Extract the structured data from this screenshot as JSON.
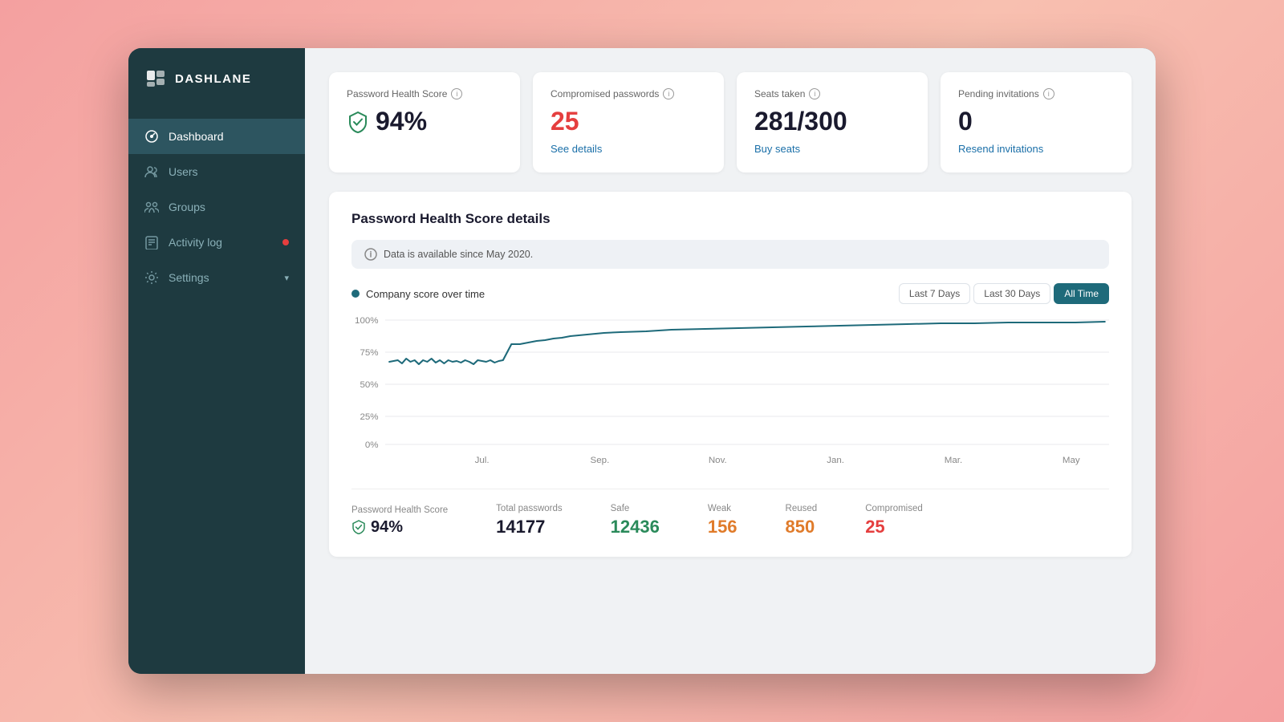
{
  "app": {
    "name": "DASHLANE"
  },
  "sidebar": {
    "items": [
      {
        "id": "dashboard",
        "label": "Dashboard",
        "icon": "dashboard-icon",
        "active": true
      },
      {
        "id": "users",
        "label": "Users",
        "icon": "users-icon",
        "active": false
      },
      {
        "id": "groups",
        "label": "Groups",
        "icon": "groups-icon",
        "active": false
      },
      {
        "id": "activity-log",
        "label": "Activity log",
        "icon": "activity-icon",
        "active": false,
        "badge": true
      },
      {
        "id": "settings",
        "label": "Settings",
        "icon": "settings-icon",
        "active": false,
        "chevron": true
      }
    ]
  },
  "stats": {
    "health_score": {
      "title": "Password Health Score",
      "value": "94%",
      "link": null
    },
    "compromised": {
      "title": "Compromised passwords",
      "value": "25",
      "link": "See details"
    },
    "seats": {
      "title": "Seats taken",
      "value": "281/300",
      "link": "Buy seats"
    },
    "invitations": {
      "title": "Pending invitations",
      "value": "0",
      "link": "Resend invitations"
    }
  },
  "chart": {
    "title": "Password Health Score details",
    "notice": "Data is available since May 2020.",
    "legend": "Company score over time",
    "time_buttons": [
      "Last 7 Days",
      "Last 30 Days",
      "All Time"
    ],
    "active_time": "All Time",
    "y_labels": [
      "100%",
      "75%",
      "50%",
      "25%",
      "0%"
    ],
    "x_labels": [
      "Jul.",
      "Sep.",
      "Nov.",
      "Jan.",
      "Mar.",
      "May"
    ]
  },
  "bottom_stats": {
    "health_score_label": "Password Health Score",
    "health_score_value": "94%",
    "total_label": "Total passwords",
    "total_value": "14177",
    "safe_label": "Safe",
    "safe_value": "12436",
    "weak_label": "Weak",
    "weak_value": "156",
    "reused_label": "Reused",
    "reused_value": "850",
    "compromised_label": "Compromised",
    "compromised_value": "25"
  }
}
